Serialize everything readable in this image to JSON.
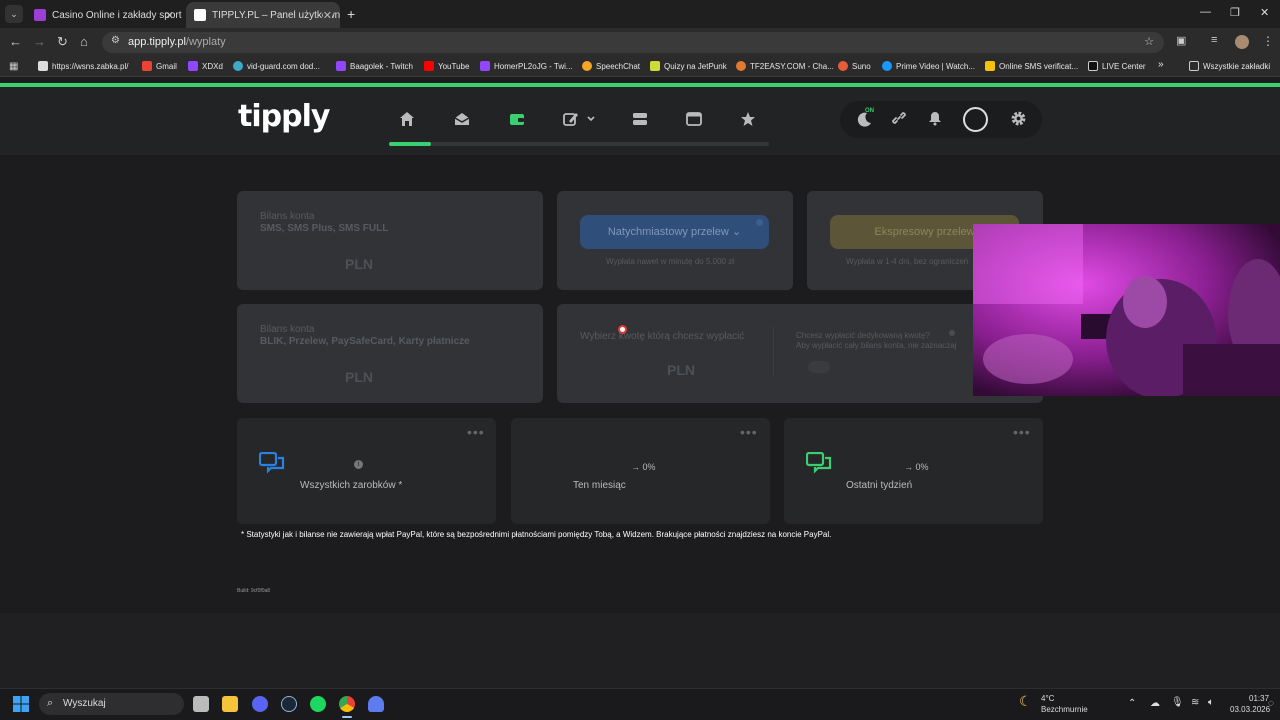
{
  "browser": {
    "tabs": [
      {
        "title": "Casino Online i zakłady sportow",
        "favicon_color": "#9b3fd6"
      },
      {
        "title": "TIPPLY.PL – Panel użytkownika",
        "favicon_color": "#ffffff"
      }
    ],
    "new_tab": "+",
    "url_host": "app.tipply.pl",
    "url_path": "/wyplaty",
    "bookmarks": [
      "https://wsns.zabka.pl/",
      "Gmail",
      "XDXd",
      "vid-guard.com dod...",
      "Baagolek - Twitch",
      "YouTube",
      "HomerPL2oJG - Twi...",
      "SpeechChat",
      "Quizy na JetPunk",
      "TF2EASY.COM - Cha...",
      "Suno",
      "Prime Video | Watch...",
      "Online SMS verificat...",
      "LIVE Center"
    ],
    "bookmarks_more": "»",
    "all_bookmarks": "Wszystkie zakładki"
  },
  "app": {
    "logo": "tipply",
    "nav_progress_fraction": 0.11,
    "toggle_badge": "ON",
    "balance_cards": [
      {
        "label": "Bilans konta",
        "sources": "SMS, SMS Plus, SMS FULL",
        "currency": "PLN"
      },
      {
        "label": "Bilans konta",
        "sources": "BLIK, Przelew, PaySafeCard, Karty płatnicze",
        "currency": "PLN"
      }
    ],
    "transfer_options": [
      {
        "label": "Natychmiastowy przelew",
        "caption": "Wypłata nawet w minutę do 5.000 zł",
        "color": "#2f4f7a"
      },
      {
        "label": "Ekspresowy przelew",
        "caption": "Wypłata w 1-4 dni, bez ograniczeń",
        "color": "#5c5538"
      }
    ],
    "amount_prompt": "Wybierz kwotę którą chcesz wypłacić",
    "amount_currency": "PLN",
    "custom_amount_question": "Chcesz wypłacić dedykowaną kwotę?",
    "custom_amount_hint": "Aby wypłacić cały bilans konta, nie zaznaczaj",
    "stats": [
      {
        "label": "Wszystkich zarobków *",
        "change": "",
        "icon_color": "#2d7fe0"
      },
      {
        "label": "Ten miesiąc",
        "change": "→ 0%",
        "icon_color": ""
      },
      {
        "label": "Ostatni tydzień",
        "change": "→ 0%",
        "icon_color": "#3bcf6f"
      }
    ],
    "more_dots": "•••",
    "footnote": "* Statystyki jak i bilanse nie zawierają wpłat PayPal, które są bezpośrednimi płatnościami pomiędzy Tobą, a Widzem. Brakujące płatności znajdziesz na koncie PayPal.",
    "build": "Build: 9cf0f0a8"
  },
  "taskbar": {
    "search": "Wyszukaj",
    "weather_temp": "4°C",
    "weather_desc": "Bezchmurnie",
    "time": "01:37",
    "date": "03.03.2026"
  }
}
